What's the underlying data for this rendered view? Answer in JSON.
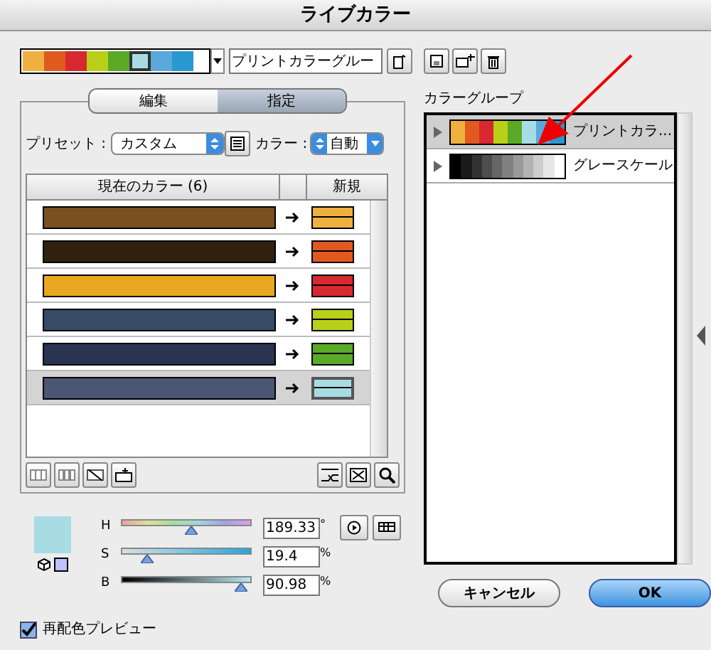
{
  "window": {
    "title": "ライブカラー"
  },
  "harmony_strip": {
    "swatches": [
      {
        "color": "#f0b040",
        "selected": false
      },
      {
        "color": "#e05a20",
        "selected": false
      },
      {
        "color": "#d82830",
        "selected": false
      },
      {
        "color": "#b8d018",
        "selected": false
      },
      {
        "color": "#5aaa28",
        "selected": false
      },
      {
        "color": "#a8dce4",
        "selected": true
      },
      {
        "color": "#5aa8dc",
        "selected": false
      },
      {
        "color": "#2898d0",
        "selected": false
      }
    ],
    "group_name": "プリントカラーグルー"
  },
  "tabs": [
    {
      "label": "編集",
      "selected": false
    },
    {
      "label": "指定",
      "selected": true
    }
  ],
  "preset": {
    "label": "プリセット :",
    "value": "カスタム"
  },
  "color_mode": {
    "label": "カラー :",
    "value": "自動"
  },
  "table": {
    "columns": [
      "現在のカラー (6)",
      "新規"
    ],
    "rows": [
      {
        "current": {
          "color": "#7a5020"
        },
        "new": {
          "color": "#f0b040"
        },
        "selected": false
      },
      {
        "current": {
          "color": "#30220e"
        },
        "new": {
          "color": "#e05a20"
        },
        "selected": false
      },
      {
        "current": {
          "color": "#e8a820"
        },
        "new": {
          "color": "#d82830"
        },
        "selected": false
      },
      {
        "current": {
          "color": "#384a68"
        },
        "new": {
          "color": "#b8d018"
        },
        "selected": false
      },
      {
        "current": {
          "color": "#283452"
        },
        "new": {
          "color": "#5aaa28"
        },
        "selected": false
      },
      {
        "current": {
          "color": "#4c5674"
        },
        "new": {
          "color": "#a8dce4"
        },
        "selected": true
      }
    ]
  },
  "sliders": [
    {
      "label": "H",
      "level": 0.53,
      "value": "189.33",
      "unit": "°"
    },
    {
      "label": "S",
      "level": 0.2,
      "value": "19.4",
      "unit": "%"
    },
    {
      "label": "B",
      "level": 0.91,
      "value": "90.98",
      "unit": "%"
    }
  ],
  "recolor_preview": {
    "label": "再配色プレビュー",
    "checked": true
  },
  "color_groups": {
    "label": "カラーグループ",
    "items": [
      {
        "name": "プリントカラ...",
        "selected": true,
        "colors": [
          {
            "color": "#f0b040"
          },
          {
            "color": "#e05a20"
          },
          {
            "color": "#d82830"
          },
          {
            "color": "#b8d018"
          },
          {
            "color": "#5aaa28"
          },
          {
            "color": "#a8dce4"
          },
          {
            "color": "#5aa8dc"
          },
          {
            "color": "#2898d0"
          }
        ]
      },
      {
        "name": "グレースケール",
        "selected": false,
        "colors": [
          {
            "color": "#000000"
          },
          {
            "color": "#1a1a1a"
          },
          {
            "color": "#333333"
          },
          {
            "color": "#4d4d4d"
          },
          {
            "color": "#666666"
          },
          {
            "color": "#808080"
          },
          {
            "color": "#999999"
          },
          {
            "color": "#b3b3b3"
          },
          {
            "color": "#cccccc"
          },
          {
            "color": "#e6e6e6"
          },
          {
            "color": "#ffffff"
          }
        ]
      }
    ]
  },
  "buttons": [
    {
      "label": "キャンセル",
      "kind": "secondary"
    },
    {
      "label": "OK",
      "kind": "default"
    }
  ]
}
